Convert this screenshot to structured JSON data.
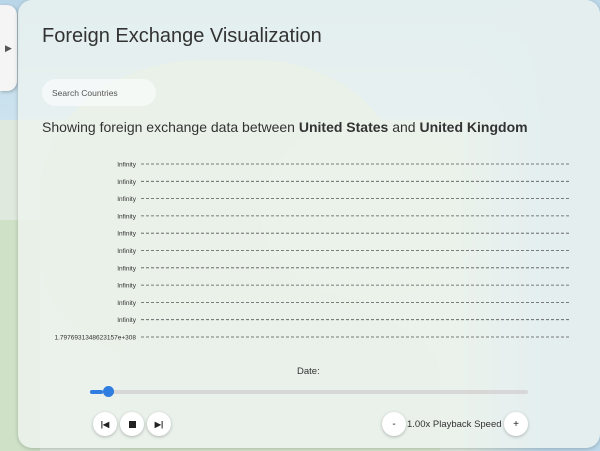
{
  "panel": {
    "title": "Foreign Exchange Visualization",
    "search_placeholder": "Search Countries",
    "subtitle_prefix": "Showing foreign exchange data between ",
    "country_a": "United States",
    "subtitle_mid": " and ",
    "country_b": "United Kingdom"
  },
  "side_toggle": {
    "icon": "triangle-right-icon",
    "glyph": "▶"
  },
  "chart_data": {
    "type": "table",
    "rows": [
      {
        "label": "Infinity"
      },
      {
        "label": "Infinity"
      },
      {
        "label": "Infinity"
      },
      {
        "label": "Infinity"
      },
      {
        "label": "Infinity"
      },
      {
        "label": "Infinity"
      },
      {
        "label": "Infinity"
      },
      {
        "label": "Infinity"
      },
      {
        "label": "Infinity"
      },
      {
        "label": "Infinity"
      },
      {
        "label": "1.7976931348623157e+308"
      }
    ],
    "grid": "dashed"
  },
  "playback": {
    "date_label": "Date:",
    "slider_value_fraction": 0.03,
    "skip_back_glyph": "|◀",
    "stop_icon": "stop-icon",
    "skip_forward_glyph": "▶|",
    "minus_label": "-",
    "speed_label": "1.00x Playback Speed",
    "plus_label": "+"
  },
  "colors": {
    "accent": "#2f7de1",
    "grid_line": "#555555"
  }
}
